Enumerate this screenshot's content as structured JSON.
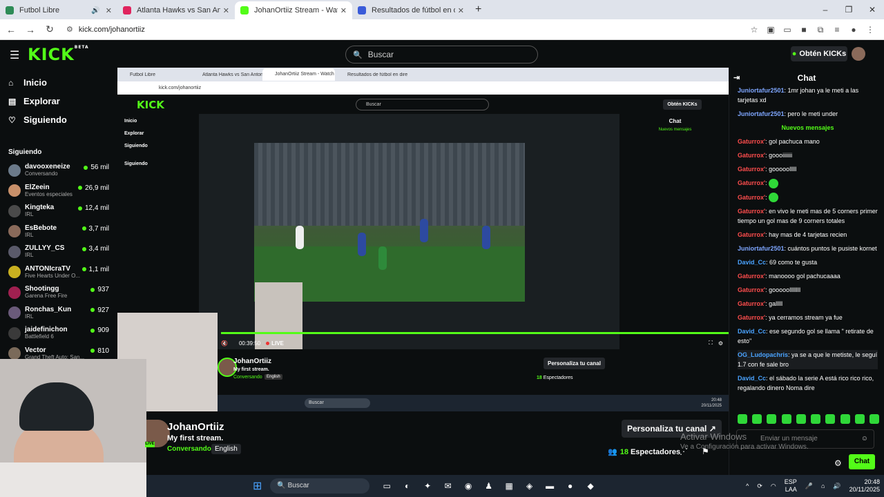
{
  "browser": {
    "tabs": [
      {
        "label": "Futbol Libre",
        "color": "#2e8b57"
      },
      {
        "label": "Atlanta Hawks vs San Antonio S",
        "color": "#e0245e"
      },
      {
        "label": "JohanOrtiiz Stream - Watch Live",
        "color": "#53fc18"
      },
      {
        "label": "Resultados de fútbol en directo",
        "color": "#3a5bd9"
      }
    ],
    "url": "kick.com/johanortiiz"
  },
  "header": {
    "logo": "KICK",
    "logo_sup": "BETA",
    "search_placeholder": "Buscar",
    "kicks_button": "Obtén KICKs"
  },
  "sidebar": {
    "nav": [
      {
        "label": "Inicio",
        "icon": "home-icon"
      },
      {
        "label": "Explorar",
        "icon": "browse-icon"
      },
      {
        "label": "Siguiendo",
        "icon": "heart-icon"
      }
    ],
    "following_title": "Siguiendo",
    "channels": [
      {
        "name": "davooxeneize",
        "category": "Conversando",
        "viewers": "56 mil",
        "color": "#6b7a8a"
      },
      {
        "name": "ElZeein",
        "category": "Eventos especiales",
        "viewers": "26,9 mil",
        "color": "#c8906a"
      },
      {
        "name": "Kingteka",
        "category": "IRL",
        "viewers": "12,4 mil",
        "color": "#4a4a4a"
      },
      {
        "name": "EsBebote",
        "category": "IRL",
        "viewers": "3,7 mil",
        "color": "#8a6a5a"
      },
      {
        "name": "ZULLYY_CS",
        "category": "IRL",
        "viewers": "3,4 mil",
        "color": "#5a5a6a"
      },
      {
        "name": "ANTONIcraTV",
        "category": "Five Hearts Under O...",
        "viewers": "1,1 mil",
        "color": "#c9b020"
      },
      {
        "name": "Shootingg",
        "category": "Garena Free Fire",
        "viewers": "937",
        "color": "#a02050"
      },
      {
        "name": "Ronchas_Kun",
        "category": "IRL",
        "viewers": "927",
        "color": "#6a5a7a"
      },
      {
        "name": "jaidefinichon",
        "category": "Battlefield 6",
        "viewers": "909",
        "color": "#3a3a3a"
      },
      {
        "name": "Vector",
        "category": "Grand Theft Auto: San...",
        "viewers": "810",
        "color": "#7a6a5a"
      }
    ]
  },
  "stream": {
    "name": "JohanOrtiiz",
    "title": "My first stream.",
    "category": "Conversando",
    "language": "English",
    "customize_button": "Personaliza tu canal",
    "viewers": "18",
    "viewers_label": "Espectadores",
    "time": "00:39:50",
    "live": "LIVE",
    "live_badge": "LIVE"
  },
  "chat": {
    "title": "Chat",
    "separator": "Nuevos mensajes",
    "messages": [
      {
        "user": "Juniortafur2501",
        "text": ": 1mr johan ya le meti a las tarjetas xd",
        "color": "#7ea6ff"
      },
      {
        "user": "Juniortafur2501",
        "text": ": pero le meti under",
        "color": "#7ea6ff"
      },
      {
        "user": "Gaturrox'",
        "text": ": gol pachuca mano",
        "color": "#ff4d4d"
      },
      {
        "user": "Gaturrox'",
        "text": ": goooiiiiiii",
        "color": "#ff4d4d"
      },
      {
        "user": "Gaturrox'",
        "text": ": gooooolllll",
        "color": "#ff4d4d"
      },
      {
        "user": "Gaturrox'",
        "text": ": ",
        "color": "#ff4d4d",
        "emote": true
      },
      {
        "user": "Gaturrox'",
        "text": ": ",
        "color": "#ff4d4d",
        "emote": true
      },
      {
        "user": "Gaturrox'",
        "text": ": en vivo le meti mas de 5 corners primer tiempo un gol mas de 9 corners totales",
        "color": "#ff4d4d"
      },
      {
        "user": "Gaturrox'",
        "text": ": hay mas de 4 tarjetas recien",
        "color": "#ff4d4d"
      },
      {
        "user": "Juniortafur2501",
        "text": ": cuántos puntos le pusiste kornet",
        "color": "#7ea6ff"
      },
      {
        "user": "David_Cc",
        "text": ": 69 como te gusta",
        "color": "#4aa3ff"
      },
      {
        "user": "Gaturrox'",
        "text": ": manoooo gol pachucaaaa",
        "color": "#ff4d4d"
      },
      {
        "user": "Gaturrox'",
        "text": ": gooooollllllll",
        "color": "#ff4d4d"
      },
      {
        "user": "Gaturrox'",
        "text": ": galllll",
        "color": "#ff4d4d"
      },
      {
        "user": "Gaturrox'",
        "text": ": ya cerramos stream ya fue",
        "color": "#ff4d4d"
      },
      {
        "user": "David_Cc",
        "text": ": ese segundo gol se llama \" retirate de esto\"",
        "color": "#4aa3ff"
      },
      {
        "user": "OG_Ludopachris",
        "text": ": ya se a que le metiste, le seguí 1.7 con fe sale bro",
        "color": "#4aa3ff",
        "hover": true
      },
      {
        "user": "David_Cc",
        "text": ": el sábado la serie A está rico rico rico, regalando dinero Noma dire",
        "color": "#4aa3ff"
      }
    ],
    "input_placeholder": "Enviar un mensaje",
    "send_button": "Chat"
  },
  "watermark": {
    "line1": "Activar Windows",
    "line2": "Ve a Configuración para activar Windows."
  },
  "taskbar": {
    "search": "Buscar",
    "lang": "ESP",
    "lang2": "LAA",
    "time": "20:48",
    "date": "20/11/2025"
  },
  "nested": {
    "url": "kick.com/johanortiiz",
    "search": "Buscar",
    "kicks": "Obtén KICKs",
    "chat_title": "Chat",
    "separator": "Nuevos mensajes",
    "nav": [
      "Inicio",
      "Explorar",
      "Siguiendo"
    ],
    "following": "Siguiendo",
    "taskbar_search": "Buscar",
    "taskbar_time": "20:48",
    "taskbar_date": "20/11/2025"
  }
}
